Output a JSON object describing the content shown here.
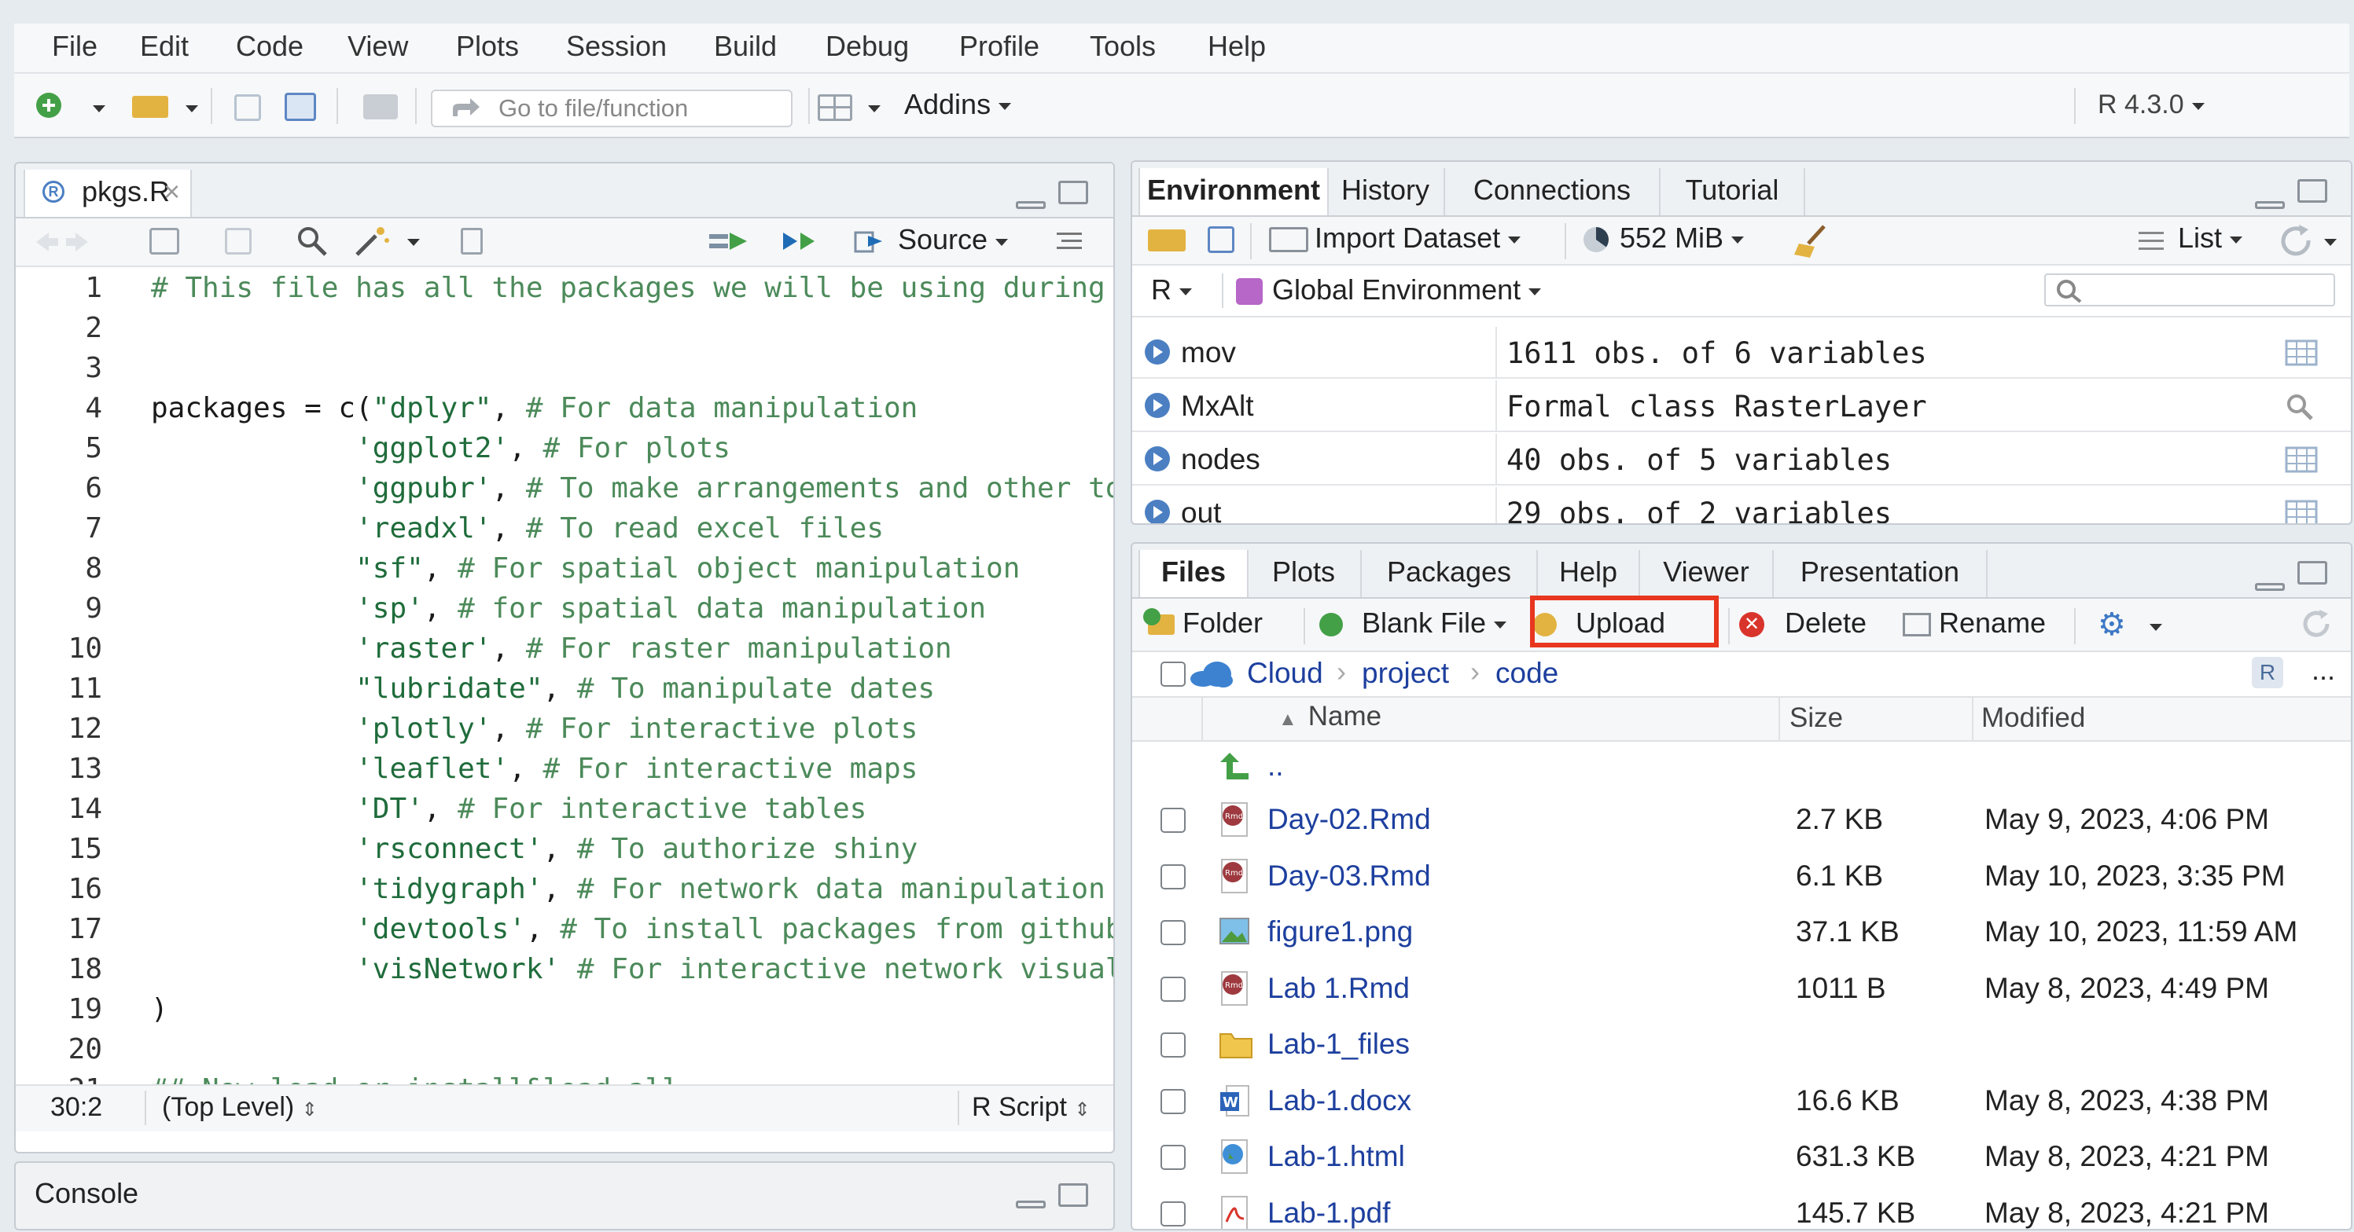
{
  "menu": [
    "File",
    "Edit",
    "Code",
    "View",
    "Plots",
    "Session",
    "Build",
    "Debug",
    "Profile",
    "Tools",
    "Help"
  ],
  "toolbar": {
    "goto_placeholder": "Go to file/function",
    "addins": "Addins",
    "r_version": "R 4.3.0"
  },
  "editor": {
    "tab_label": "pkgs.R",
    "source_label": "Source",
    "lines": [
      {
        "n": "1",
        "parts": [
          [
            "cm",
            "# This file has all the packages we will be using during t"
          ]
        ]
      },
      {
        "n": "2",
        "parts": []
      },
      {
        "n": "3",
        "parts": []
      },
      {
        "n": "4",
        "parts": [
          [
            "",
            "packages = c("
          ],
          [
            "str",
            "\"dplyr\""
          ],
          [
            "",
            ", "
          ],
          [
            "cm",
            "# For data manipulation"
          ]
        ]
      },
      {
        "n": "5",
        "parts": [
          [
            "",
            "            "
          ],
          [
            "str",
            "'ggplot2'"
          ],
          [
            "",
            ", "
          ],
          [
            "cm",
            "# For plots"
          ]
        ]
      },
      {
        "n": "6",
        "parts": [
          [
            "",
            "            "
          ],
          [
            "str",
            "'ggpubr'"
          ],
          [
            "",
            ", "
          ],
          [
            "cm",
            "# To make arrangements and other to"
          ]
        ]
      },
      {
        "n": "7",
        "parts": [
          [
            "",
            "            "
          ],
          [
            "str",
            "'readxl'"
          ],
          [
            "",
            ", "
          ],
          [
            "cm",
            "# To read excel files"
          ]
        ]
      },
      {
        "n": "8",
        "parts": [
          [
            "",
            "            "
          ],
          [
            "str",
            "\"sf\""
          ],
          [
            "",
            ", "
          ],
          [
            "cm",
            "# For spatial object manipulation"
          ]
        ]
      },
      {
        "n": "9",
        "parts": [
          [
            "",
            "            "
          ],
          [
            "str",
            "'sp'"
          ],
          [
            "",
            ", "
          ],
          [
            "cm",
            "# for spatial data manipulation"
          ]
        ]
      },
      {
        "n": "10",
        "parts": [
          [
            "",
            "            "
          ],
          [
            "str",
            "'raster'"
          ],
          [
            "",
            ", "
          ],
          [
            "cm",
            "# For raster manipulation"
          ]
        ]
      },
      {
        "n": "11",
        "parts": [
          [
            "",
            "            "
          ],
          [
            "str",
            "\"lubridate\""
          ],
          [
            "",
            ", "
          ],
          [
            "cm",
            "# To manipulate dates"
          ]
        ]
      },
      {
        "n": "12",
        "parts": [
          [
            "",
            "            "
          ],
          [
            "str",
            "'plotly'"
          ],
          [
            "",
            ", "
          ],
          [
            "cm",
            "# For interactive plots"
          ]
        ]
      },
      {
        "n": "13",
        "parts": [
          [
            "",
            "            "
          ],
          [
            "str",
            "'leaflet'"
          ],
          [
            "",
            ", "
          ],
          [
            "cm",
            "# For interactive maps"
          ]
        ]
      },
      {
        "n": "14",
        "parts": [
          [
            "",
            "            "
          ],
          [
            "str",
            "'DT'"
          ],
          [
            "",
            ", "
          ],
          [
            "cm",
            "# For interactive tables"
          ]
        ]
      },
      {
        "n": "15",
        "parts": [
          [
            "",
            "            "
          ],
          [
            "str",
            "'rsconnect'"
          ],
          [
            "",
            ", "
          ],
          [
            "cm",
            "# To authorize shiny"
          ]
        ]
      },
      {
        "n": "16",
        "parts": [
          [
            "",
            "            "
          ],
          [
            "str",
            "'tidygraph'"
          ],
          [
            "",
            ", "
          ],
          [
            "cm",
            "# For network data manipulation"
          ]
        ]
      },
      {
        "n": "17",
        "parts": [
          [
            "",
            "            "
          ],
          [
            "str",
            "'devtools'"
          ],
          [
            "",
            ", "
          ],
          [
            "cm",
            "# To install packages from github"
          ]
        ]
      },
      {
        "n": "18",
        "parts": [
          [
            "",
            "            "
          ],
          [
            "str",
            "'visNetwork'"
          ],
          [
            "cm",
            " # For interactive network visual"
          ]
        ]
      },
      {
        "n": "19",
        "parts": [
          [
            "",
            ")"
          ]
        ]
      },
      {
        "n": "20",
        "parts": []
      },
      {
        "n": "21",
        "parts": [
          [
            "cm",
            "## Now load or install&load all"
          ]
        ]
      }
    ],
    "status_pos": "30:2",
    "status_scope": "(Top Level)",
    "status_type": "R Script"
  },
  "console": {
    "label": "Console"
  },
  "env": {
    "tabs": [
      "Environment",
      "History",
      "Connections",
      "Tutorial"
    ],
    "import_label": "Import Dataset",
    "memory": "552 MiB",
    "view_mode": "List",
    "lang": "R",
    "scope": "Global Environment",
    "rows": [
      {
        "name": "mov",
        "value": "1611 obs. of 6 variables"
      },
      {
        "name": "MxAlt",
        "value": "Formal class  RasterLayer"
      },
      {
        "name": "nodes",
        "value": "40 obs. of 5 variables"
      },
      {
        "name": "out",
        "value": "29 obs. of 2 variables"
      }
    ]
  },
  "files": {
    "tabs": [
      "Files",
      "Plots",
      "Packages",
      "Help",
      "Viewer",
      "Presentation"
    ],
    "actions": {
      "folder": "Folder",
      "blank": "Blank File",
      "upload": "Upload",
      "delete": "Delete",
      "rename": "Rename"
    },
    "breadcrumb": [
      "Cloud",
      "project",
      "code"
    ],
    "more": "...",
    "columns": {
      "name": "Name",
      "size": "Size",
      "modified": "Modified"
    },
    "parent": "..",
    "rows": [
      {
        "icon": "rmd",
        "name": "Day-02.Rmd",
        "size": "2.7 KB",
        "modified": "May 9, 2023, 4:06 PM"
      },
      {
        "icon": "rmd",
        "name": "Day-03.Rmd",
        "size": "6.1 KB",
        "modified": "May 10, 2023, 3:35 PM"
      },
      {
        "icon": "png",
        "name": "figure1.png",
        "size": "37.1 KB",
        "modified": "May 10, 2023, 11:59 AM"
      },
      {
        "icon": "rmd",
        "name": "Lab 1.Rmd",
        "size": "1011 B",
        "modified": "May 8, 2023, 4:49 PM"
      },
      {
        "icon": "folder",
        "name": "Lab-1_files",
        "size": "",
        "modified": ""
      },
      {
        "icon": "docx",
        "name": "Lab-1.docx",
        "size": "16.6 KB",
        "modified": "May 8, 2023, 4:38 PM"
      },
      {
        "icon": "html",
        "name": "Lab-1.html",
        "size": "631.3 KB",
        "modified": "May 8, 2023, 4:21 PM"
      },
      {
        "icon": "pdf",
        "name": "Lab-1.pdf",
        "size": "145.7 KB",
        "modified": "May 8, 2023, 4:21 PM"
      }
    ]
  },
  "colors": {
    "highlight_box": "#e8361f",
    "link": "#1d3f9e",
    "comment": "#4c8a5a"
  }
}
